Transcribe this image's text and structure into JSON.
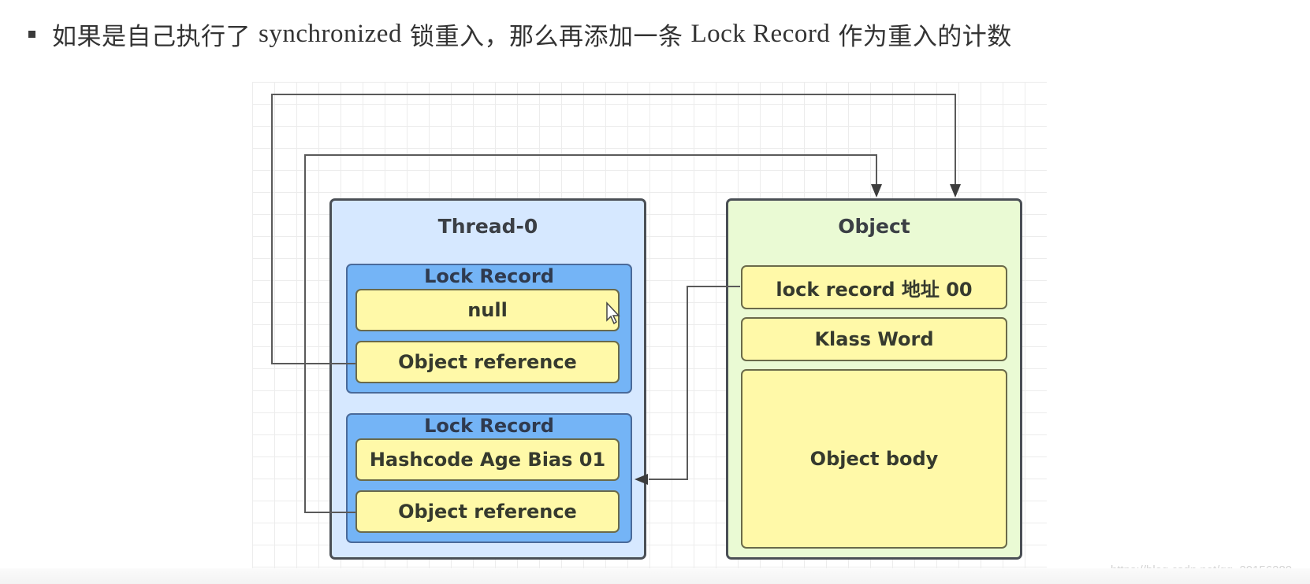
{
  "heading": {
    "bullet_icon": "square-bullet-icon",
    "text_before": "如果是自己执行了",
    "keyword": "synchronized",
    "text_middle": "锁重入，那么再添加一条",
    "keyword2": "Lock Record",
    "text_after": "作为重入的计数"
  },
  "diagram": {
    "thread": {
      "title": "Thread-0",
      "lock_records": [
        {
          "title": "Lock Record",
          "cells": [
            "null",
            "Object reference"
          ]
        },
        {
          "title": "Lock Record",
          "cells": [
            "Hashcode Age Bias 01",
            "Object reference"
          ]
        }
      ]
    },
    "object": {
      "title": "Object",
      "cells": [
        "lock record 地址 00",
        "Klass Word",
        "Object body"
      ]
    },
    "connectors": [
      {
        "from": "Lock Record 1 / Object reference",
        "to": "Object",
        "arrow": "down"
      },
      {
        "from": "Lock Record 2 / Object reference",
        "to": "Object",
        "arrow": "down"
      },
      {
        "from": "Object / lock record 地址 00",
        "to": "Lock Record 2",
        "arrow": "left"
      }
    ],
    "colors": {
      "thread_fill": "#d6e8ff",
      "lock_record_fill": "#74b4f6",
      "cell_fill": "#fff9a8",
      "object_fill": "#eafad4",
      "border": "#4a4f55",
      "connector": "#555555"
    }
  },
  "watermark": "https://blog.csdn.net/qq_20156289",
  "cursor_icon": "mouse-pointer-icon"
}
